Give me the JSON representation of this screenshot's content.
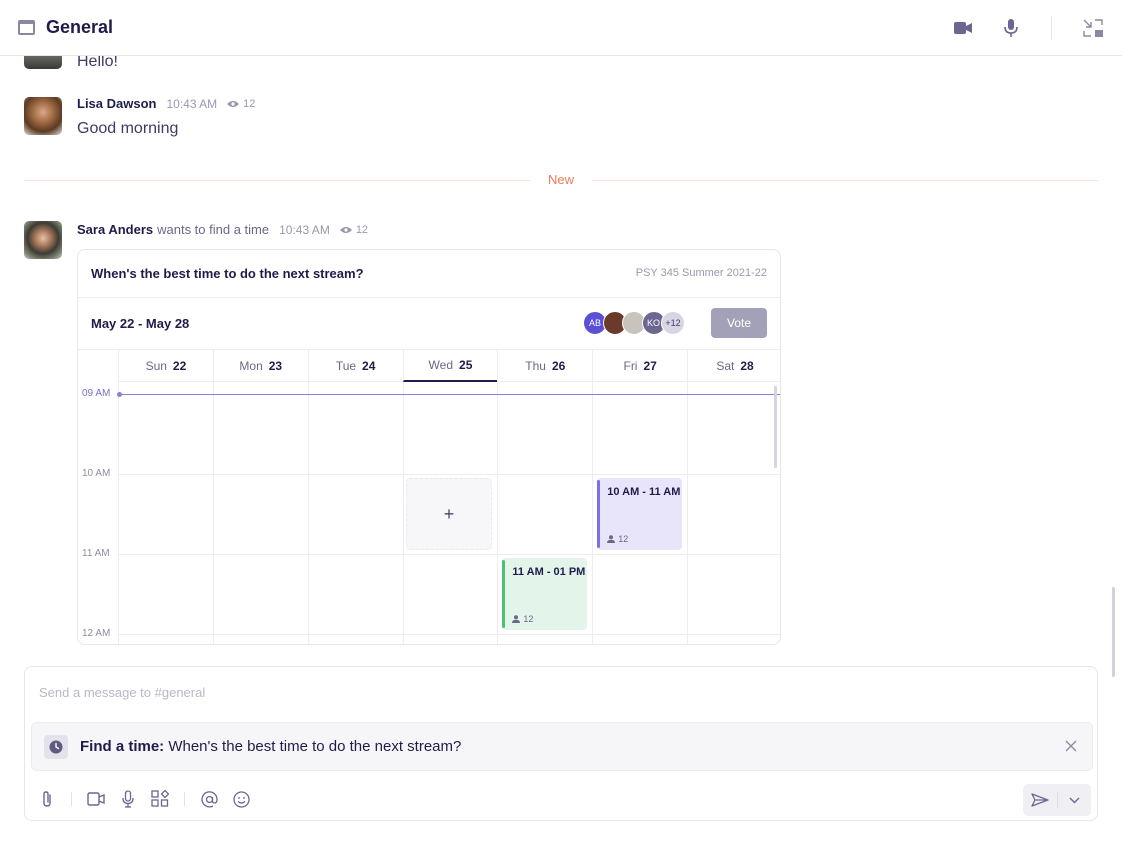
{
  "header": {
    "channel_title": "General",
    "icons": [
      "channel-icon",
      "video-camera-icon",
      "microphone-icon",
      "minimize-icon"
    ]
  },
  "messages": [
    {
      "text": "Hello!"
    },
    {
      "author": "Lisa Dawson",
      "time": "10:43 AM",
      "seen_count": "12",
      "text": "Good morning"
    }
  ],
  "divider": {
    "label": "New"
  },
  "find_time_message": {
    "author": "Sara Anders",
    "action": "wants to find a time",
    "time": "10:43 AM",
    "seen_count": "12",
    "card": {
      "question": "When's the best time to do the next stream?",
      "course": "PSY 345 Summer 2021-22",
      "date_range": "May 22 - May 28",
      "voters": [
        {
          "initials": "AB",
          "color": "#5b4fd6"
        },
        {
          "initials": "",
          "color": "#6a3a2a"
        },
        {
          "initials": "",
          "color": "#c9c3bd"
        },
        {
          "initials": "KO",
          "color": "#6b6790"
        },
        {
          "initials": "+12",
          "color": "#d8d6e2"
        }
      ],
      "vote_label": "Vote",
      "days": [
        {
          "dow": "Sun",
          "date": "22"
        },
        {
          "dow": "Mon",
          "date": "23"
        },
        {
          "dow": "Tue",
          "date": "24"
        },
        {
          "dow": "Wed",
          "date": "25",
          "active": true
        },
        {
          "dow": "Thu",
          "date": "26"
        },
        {
          "dow": "Fri",
          "date": "27"
        },
        {
          "dow": "Sat",
          "date": "28"
        }
      ],
      "hours": [
        "09 AM",
        "10 AM",
        "11 AM",
        "12 AM"
      ],
      "empty_slot_symbol": "+",
      "events": [
        {
          "day": "Fri",
          "label": "10 AM - 11 AM",
          "count": "12",
          "accent": "#7c6ee6",
          "bg": "#e8e5fb"
        },
        {
          "day": "Thu",
          "label": "11 AM - 01 PM",
          "count": "12",
          "accent": "#4fbf73",
          "bg": "#e3f4ea"
        }
      ]
    }
  },
  "composer": {
    "placeholder": "Send a message to #general",
    "value": "",
    "attachment": {
      "prefix": "Find a time:",
      "text": "When's the best time to do the next stream?"
    },
    "toolbar_icons": [
      "paperclip-icon",
      "video-icon",
      "microphone-icon",
      "apps-icon",
      "mention-icon",
      "emoji-icon"
    ]
  }
}
